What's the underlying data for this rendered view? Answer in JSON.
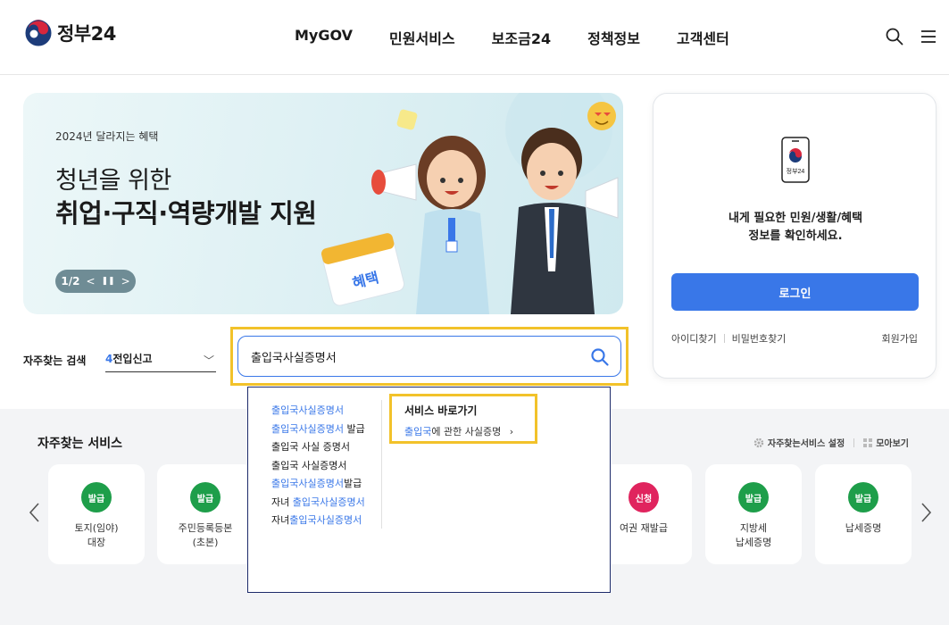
{
  "header": {
    "logo_text": "정부24",
    "nav": [
      "MyGOV",
      "민원서비스",
      "보조금24",
      "정책정보",
      "고객센터"
    ]
  },
  "banner": {
    "subtitle": "2024년 달라지는 혜택",
    "title_line1": "청년을 위한",
    "title_line2": "취업·구직·역량개발 지원",
    "pager": "1/2",
    "calendar_label": "혜택"
  },
  "login": {
    "phone_label": "정부24",
    "message_line1": "내게 필요한 민원/생활/혜택",
    "message_line2": "정보를 확인하세요.",
    "button": "로그인",
    "find_id": "아이디찾기",
    "find_pw": "비밀번호찾기",
    "signup": "회원가입"
  },
  "search": {
    "freq_label": "자주찾는 검색",
    "freq_rank": "4",
    "freq_term": "전입신고",
    "query": "출입국사실증명서"
  },
  "autocomplete": {
    "suggestions": [
      {
        "hl": "출입국사실증명서",
        "rest": "",
        "prefix": ""
      },
      {
        "hl": "출입국사실증명서",
        "rest": " 발급",
        "prefix": ""
      },
      {
        "hl": "",
        "rest": "출입국 사실 증명서",
        "prefix": ""
      },
      {
        "hl": "",
        "rest": "출입국 사실증명서",
        "prefix": ""
      },
      {
        "hl": "출입국사실증명서",
        "rest": "발급",
        "prefix": ""
      },
      {
        "hl": "출입국사실증명서",
        "rest": "",
        "prefix": "자녀 "
      },
      {
        "hl": "출입국사실증명서",
        "rest": "",
        "prefix": "자녀"
      }
    ],
    "goto_title": "서비스 바로가기",
    "goto_link_hl": "출입국",
    "goto_link_rest": "에 관한 사실증명",
    "goto_chevron": "›"
  },
  "services": {
    "title": "자주찾는 서비스",
    "settings": "자주찾는서비스 설정",
    "view_all": "모아보기",
    "cards": [
      {
        "badge": "발급",
        "line1": "토지(임야)",
        "line2": "대장",
        "color": "#1e9e4a"
      },
      {
        "badge": "발급",
        "line1": "주민등록등본",
        "line2": "(초본)",
        "color": "#1e9e4a"
      },
      {
        "badge": "신청",
        "line1": "여권 재발급",
        "line2": "",
        "color": "#e0245e"
      },
      {
        "badge": "발급",
        "line1": "지방세",
        "line2": "납세증명",
        "color": "#1e9e4a"
      },
      {
        "badge": "발급",
        "line1": "납세증명",
        "line2": "",
        "color": "#1e9e4a"
      }
    ]
  },
  "colors": {
    "accent": "#3977e8",
    "highlight_frame": "#f2c22a",
    "issue_badge": "#1e9e4a",
    "apply_badge": "#e0245e"
  }
}
